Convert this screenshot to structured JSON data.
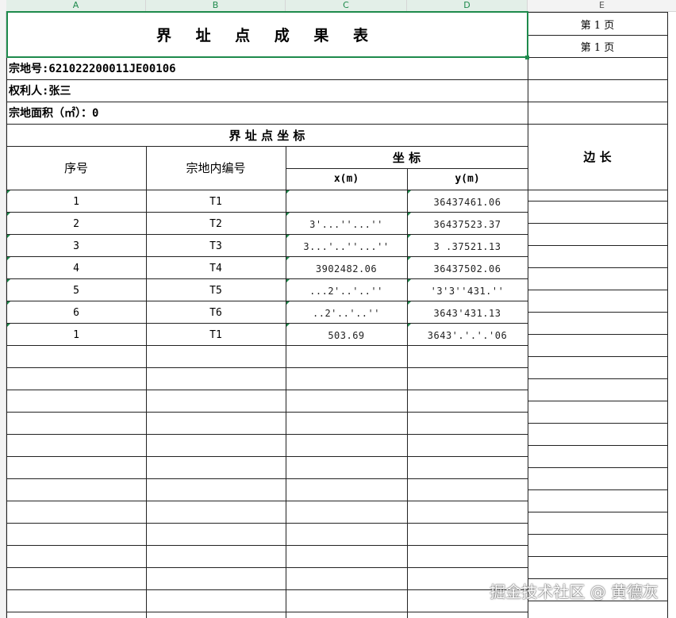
{
  "columns": [
    "A",
    "B",
    "C",
    "D",
    "E"
  ],
  "title": "界 址 点 成 果 表",
  "page_labels": [
    "第 1 页",
    "第 1 页"
  ],
  "parcel_no": "宗地号:621022200011JE00106",
  "owner": "权利人:张三",
  "area": "宗地面积（㎡）：0",
  "table": {
    "section_title": "界  址  点  坐  标",
    "seq_header": "序号",
    "code_header": "宗地内编号",
    "coord_header": "坐 标",
    "x_header": "x(m)",
    "y_header": "y(m)",
    "edge_header": "边 长"
  },
  "rows": [
    {
      "seq": "1",
      "code": "T1",
      "x": "",
      "y": "36437461.06"
    },
    {
      "seq": "2",
      "code": "T2",
      "x": "3'...''...''",
      "y": "36437523.37"
    },
    {
      "seq": "3",
      "code": "T3",
      "x": "3...'..''...''",
      "y": "3 .37521.13"
    },
    {
      "seq": "4",
      "code": "T4",
      "x": "3902482.06",
      "y": "36437502.06"
    },
    {
      "seq": "5",
      "code": "T5",
      "x": "...2'..'..''",
      "y": "'3'3''431.''"
    },
    {
      "seq": "6",
      "code": "T6",
      "x": "..2'..'..''",
      "y": "3643'431.13"
    },
    {
      "seq": "1",
      "code": "T1",
      "x": "503.69",
      "y": "3643'.'.'.'06"
    }
  ],
  "watermark": "掘金技术社区 @ 黄德灰",
  "colors": {
    "accent": "#1e8a4c",
    "grid": "#222222"
  }
}
